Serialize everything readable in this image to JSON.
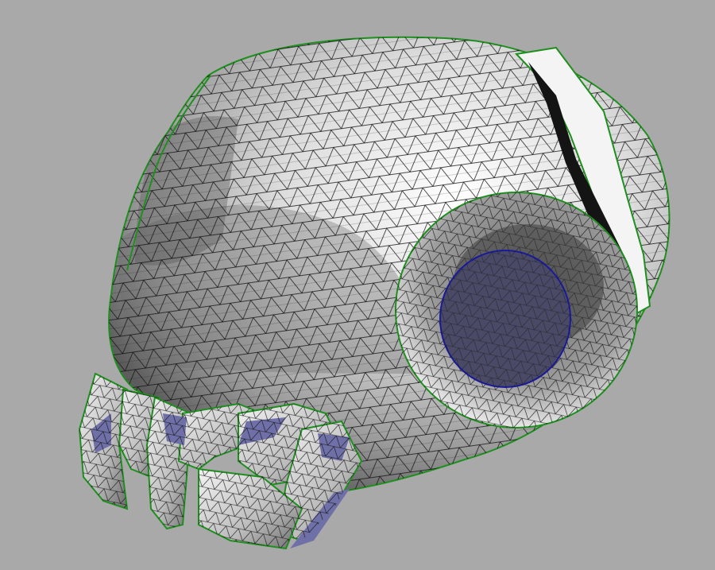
{
  "scene": {
    "subject": "triangulated-skull-mesh",
    "colors": {
      "background": "#a9a9a9",
      "mesh_light": "#f2f2f2",
      "mesh_mid": "#bdbdbd",
      "mesh_dark": "#5a5a5a",
      "wire": "#111111",
      "boundary": "#1f8f1f",
      "eye_fill": "#4a4a66",
      "eye_edge": "#1a1a9a",
      "inner_surface": "#7070a8"
    },
    "icons": [
      "skull-mesh-icon"
    ]
  }
}
